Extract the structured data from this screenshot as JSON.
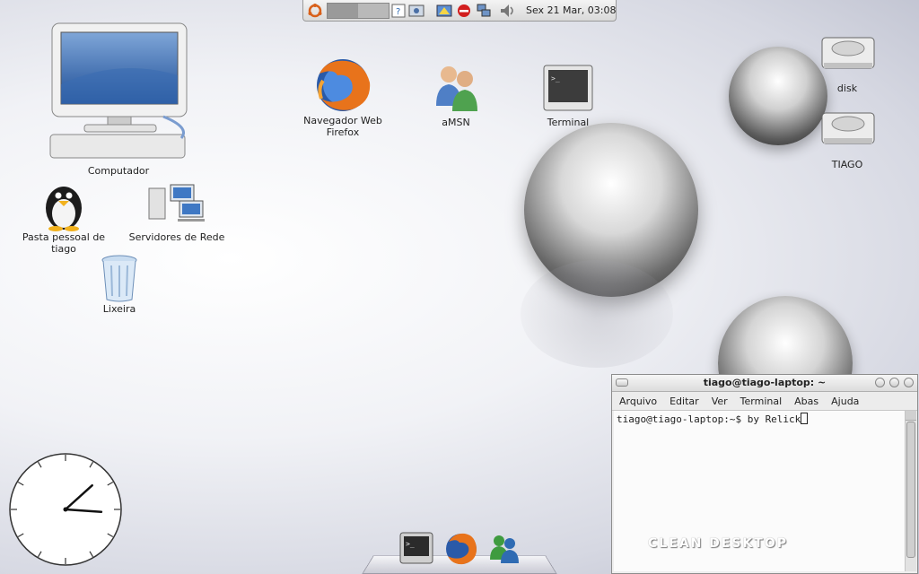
{
  "top_panel": {
    "icons": [
      "ubuntu-menu-icon",
      "workspace-switcher-icon",
      "help-icon",
      "screenshot-icon",
      "update-notifier-icon",
      "stop-icon",
      "network-icon",
      "volume-icon"
    ],
    "clock": "Sex 21 Mar, 03:08"
  },
  "desktop_icons": [
    {
      "key": "computer",
      "label": "Computador"
    },
    {
      "key": "home",
      "label": "Pasta pessoal de tiago"
    },
    {
      "key": "network",
      "label": "Servidores de Rede"
    },
    {
      "key": "trash",
      "label": "Lixeira"
    },
    {
      "key": "firefox",
      "label": "Navegador Web Firefox"
    },
    {
      "key": "amsn",
      "label": "aMSN"
    },
    {
      "key": "terminal",
      "label": "Terminal"
    },
    {
      "key": "disk",
      "label": "disk"
    },
    {
      "key": "tiago",
      "label": "TIAGO"
    }
  ],
  "terminal": {
    "title": "tiago@tiago-laptop: ~",
    "menu": [
      "Arquivo",
      "Editar",
      "Ver",
      "Terminal",
      "Abas",
      "Ajuda"
    ],
    "line": "tiago@tiago-laptop:~$ by Relick"
  },
  "watermark": "CLEAN DESKTOP",
  "dock": {
    "items": [
      "terminal-icon",
      "firefox-icon",
      "messenger-icon"
    ]
  },
  "analog_clock": {
    "hour": 3,
    "minute": 8
  },
  "colors": {
    "accent": "#2f6bb3",
    "desktop_bg": "#e8e9ef"
  }
}
